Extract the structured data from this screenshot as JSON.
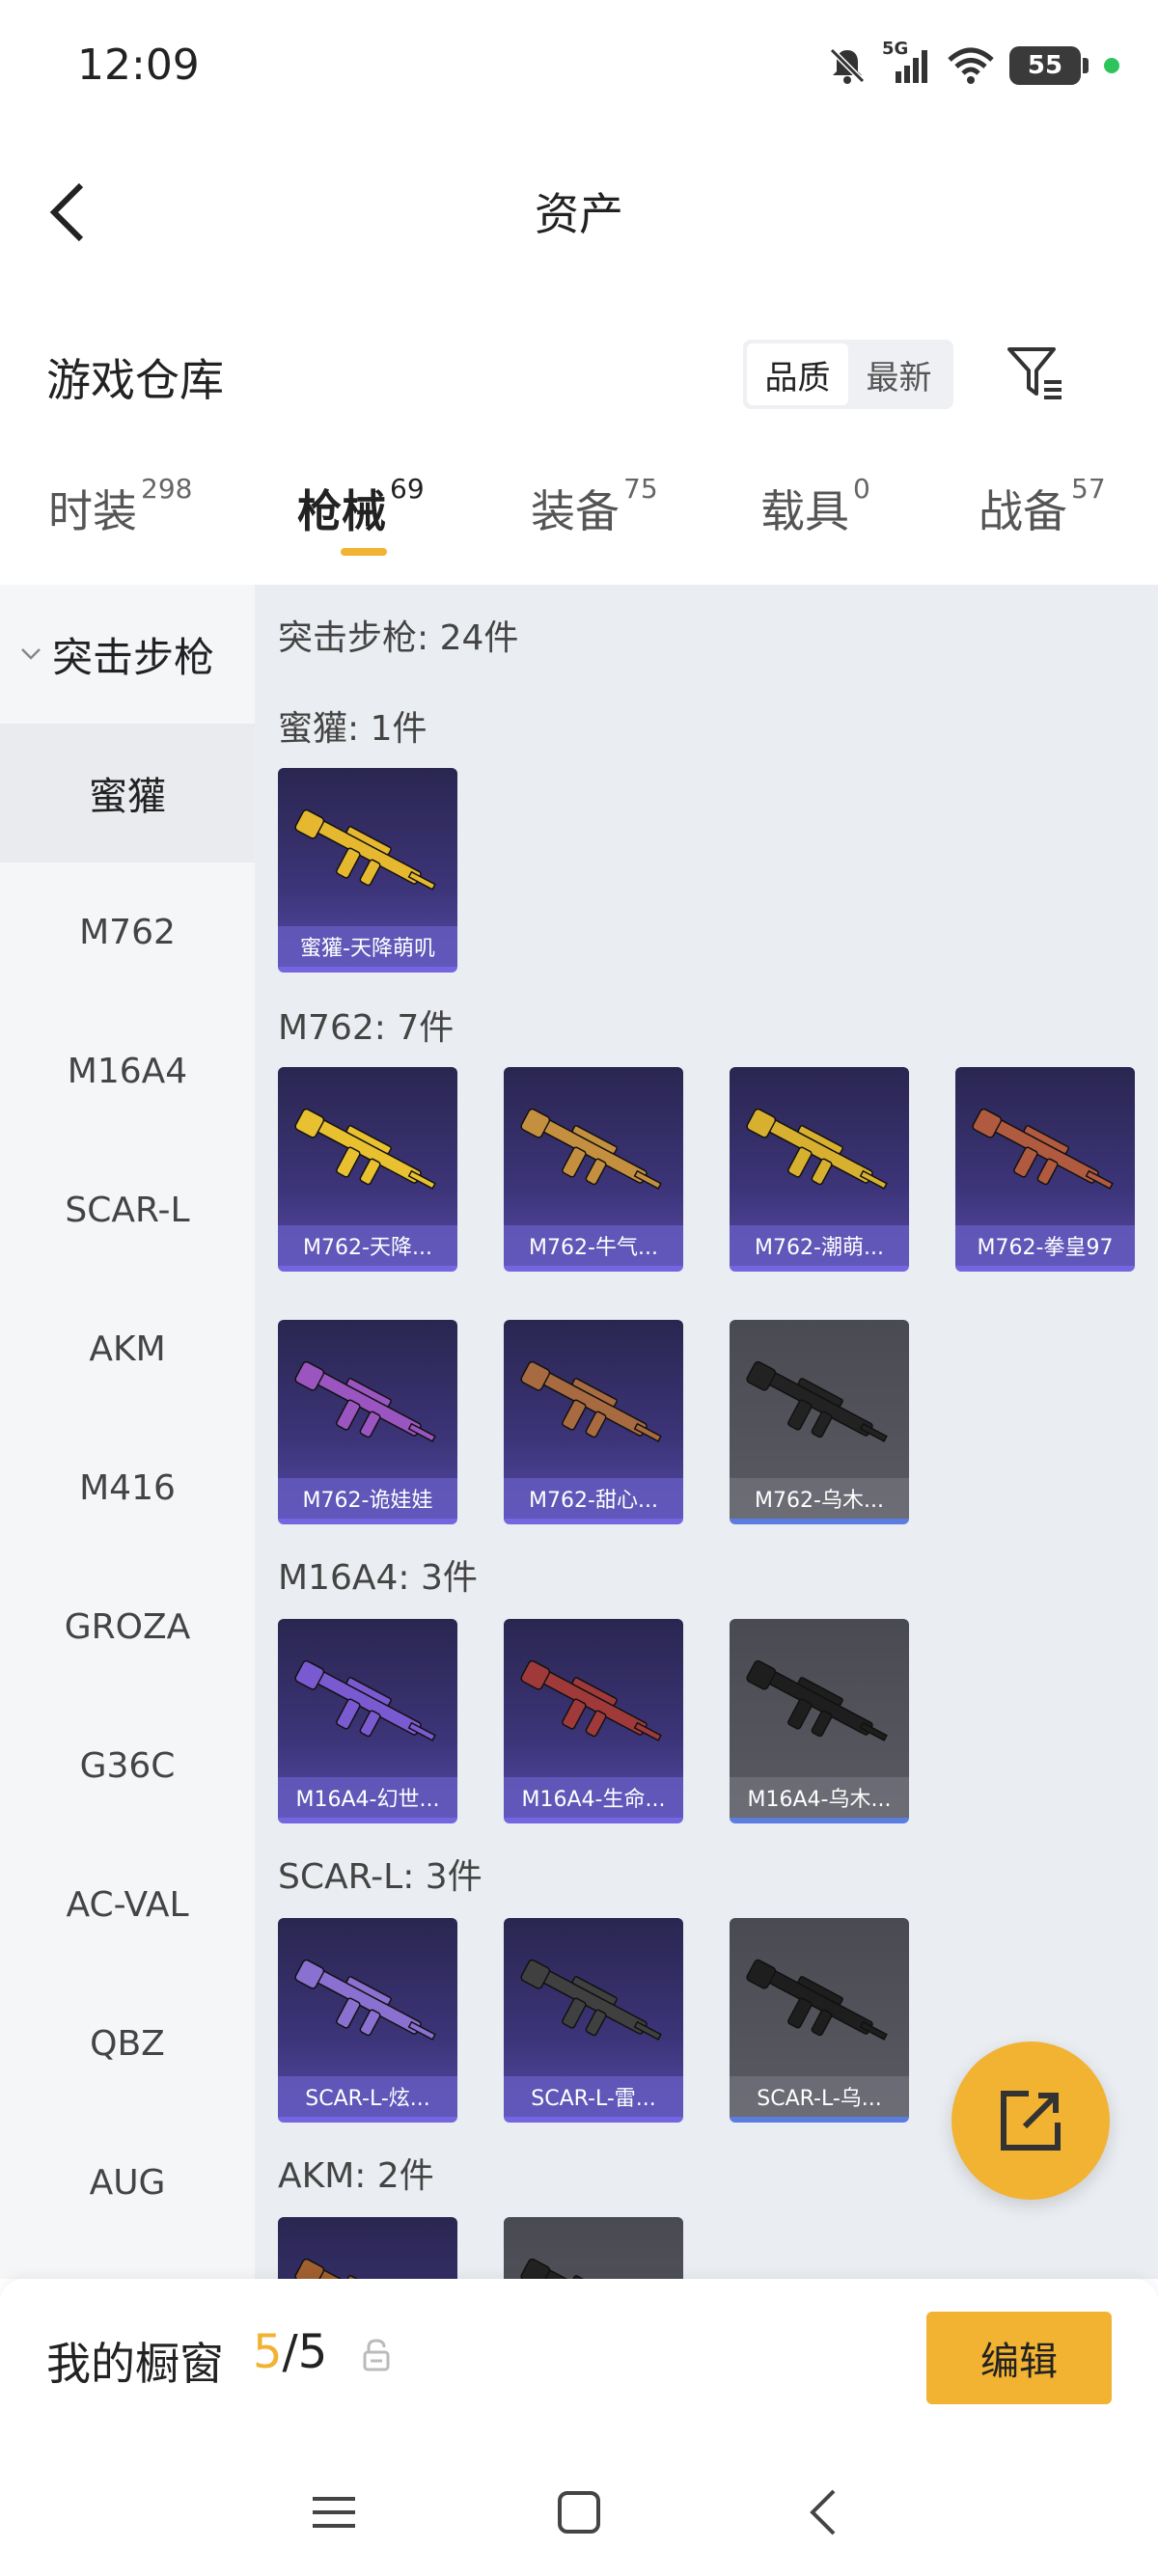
{
  "status_bar": {
    "time": "12:09",
    "network": "5G",
    "battery": "55"
  },
  "header": {
    "title": "资产"
  },
  "warehouse": {
    "title": "游戏仓库",
    "sort_options": [
      "品质",
      "最新"
    ],
    "active_sort": "品质"
  },
  "tabs": [
    {
      "label": "时装",
      "count": "298"
    },
    {
      "label": "枪械",
      "count": "69"
    },
    {
      "label": "装备",
      "count": "75"
    },
    {
      "label": "载具",
      "count": "0"
    },
    {
      "label": "战备",
      "count": "57"
    }
  ],
  "active_tab": "枪械",
  "sidebar": {
    "category": "突击步枪",
    "items": [
      "蜜獾",
      "M762",
      "M16A4",
      "SCAR-L",
      "AKM",
      "M416",
      "GROZA",
      "G36C",
      "AC-VAL",
      "QBZ",
      "AUG"
    ],
    "active_item": "蜜獾"
  },
  "content": {
    "summary": "突击步枪: 24件",
    "sections": [
      {
        "label": "蜜獾: 1件",
        "items": [
          {
            "name": "蜜獾-天降萌叽",
            "tone": "purple",
            "gun_color": "#e6b830"
          }
        ]
      },
      {
        "label": "M762: 7件",
        "items": [
          {
            "name": "M762-天降...",
            "tone": "purple",
            "gun_color": "#e8c030"
          },
          {
            "name": "M762-牛气...",
            "tone": "purple",
            "gun_color": "#c49040"
          },
          {
            "name": "M762-潮萌...",
            "tone": "purple",
            "gun_color": "#d8b030"
          },
          {
            "name": "M762-拳皇97",
            "tone": "purple",
            "gun_color": "#b05a40"
          },
          {
            "name": "M762-诡娃娃",
            "tone": "purple",
            "gun_color": "#9a55c0"
          },
          {
            "name": "M762-甜心...",
            "tone": "purple",
            "gun_color": "#a86a40"
          },
          {
            "name": "M762-乌木...",
            "tone": "gray",
            "gun_color": "#222222"
          }
        ]
      },
      {
        "label": "M16A4: 3件",
        "items": [
          {
            "name": "M16A4-幻世...",
            "tone": "purple",
            "gun_color": "#7a5ad0"
          },
          {
            "name": "M16A4-生命...",
            "tone": "purple",
            "gun_color": "#a03a3a"
          },
          {
            "name": "M16A4-乌木...",
            "tone": "gray",
            "gun_color": "#1e1e1e"
          }
        ]
      },
      {
        "label": "SCAR-L: 3件",
        "items": [
          {
            "name": "SCAR-L-炫...",
            "tone": "purple",
            "gun_color": "#8a70d0"
          },
          {
            "name": "SCAR-L-雷...",
            "tone": "purple",
            "gun_color": "#404040"
          },
          {
            "name": "SCAR-L-乌...",
            "tone": "gray",
            "gun_color": "#1e1e1e"
          }
        ]
      },
      {
        "label": "AKM: 2件",
        "items": [
          {
            "name": "",
            "tone": "purple",
            "gun_color": "#a06030"
          },
          {
            "name": "",
            "tone": "gray",
            "gun_color": "#222222"
          }
        ]
      }
    ]
  },
  "showcase": {
    "label": "我的橱窗",
    "current": "5",
    "total": "/5",
    "edit_label": "编辑"
  },
  "colors": {
    "accent": "#f2b232",
    "card_purple": "#3c3478",
    "card_gray": "#55555d"
  }
}
